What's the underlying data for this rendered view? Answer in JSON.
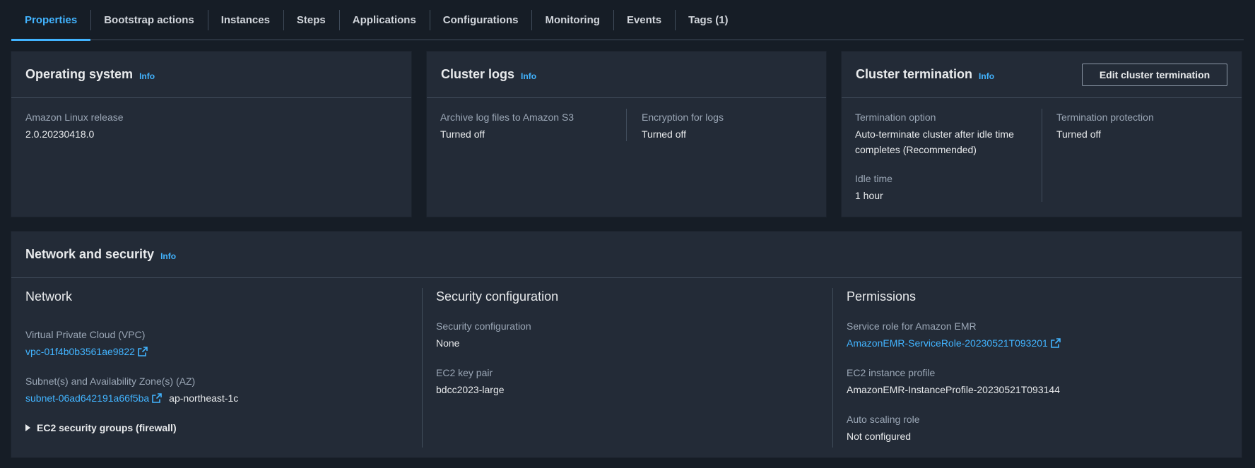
{
  "tabs": [
    {
      "label": "Properties",
      "active": true
    },
    {
      "label": "Bootstrap actions"
    },
    {
      "label": "Instances"
    },
    {
      "label": "Steps"
    },
    {
      "label": "Applications"
    },
    {
      "label": "Configurations"
    },
    {
      "label": "Monitoring"
    },
    {
      "label": "Events"
    },
    {
      "label": "Tags (1)"
    }
  ],
  "info_label": "Info",
  "os": {
    "title": "Operating system",
    "release_label": "Amazon Linux release",
    "release_value": "2.0.20230418.0"
  },
  "logs": {
    "title": "Cluster logs",
    "archive_label": "Archive log files to Amazon S3",
    "archive_value": "Turned off",
    "encryption_label": "Encryption for logs",
    "encryption_value": "Turned off"
  },
  "termination": {
    "title": "Cluster termination",
    "edit_button": "Edit cluster termination",
    "option_label": "Termination option",
    "option_value_line1": "Auto-terminate cluster after idle time",
    "option_value_line2": "completes (Recommended)",
    "idle_label": "Idle time",
    "idle_value": "1 hour",
    "protection_label": "Termination protection",
    "protection_value": "Turned off"
  },
  "network_security": {
    "title": "Network and security",
    "network": {
      "heading": "Network",
      "vpc_label": "Virtual Private Cloud (VPC)",
      "vpc_value": "vpc-01f4b0b3561ae9822",
      "subnet_label": "Subnet(s) and Availability Zone(s) (AZ)",
      "subnet_value": "subnet-06ad642191a66f5ba",
      "az_value": "ap-northeast-1c",
      "security_groups_label": "EC2 security groups (firewall)"
    },
    "security": {
      "heading": "Security configuration",
      "config_label": "Security configuration",
      "config_value": "None",
      "keypair_label": "EC2 key pair",
      "keypair_value": "bdcc2023-large"
    },
    "permissions": {
      "heading": "Permissions",
      "service_role_label": "Service role for Amazon EMR",
      "service_role_value": "AmazonEMR-ServiceRole-20230521T093201",
      "instance_profile_label": "EC2 instance profile",
      "instance_profile_value": "AmazonEMR-InstanceProfile-20230521T093144",
      "autoscaling_label": "Auto scaling role",
      "autoscaling_value": "Not configured"
    }
  },
  "colors": {
    "accent": "#42b4ff",
    "panel": "#232b37",
    "background": "#161d26"
  }
}
